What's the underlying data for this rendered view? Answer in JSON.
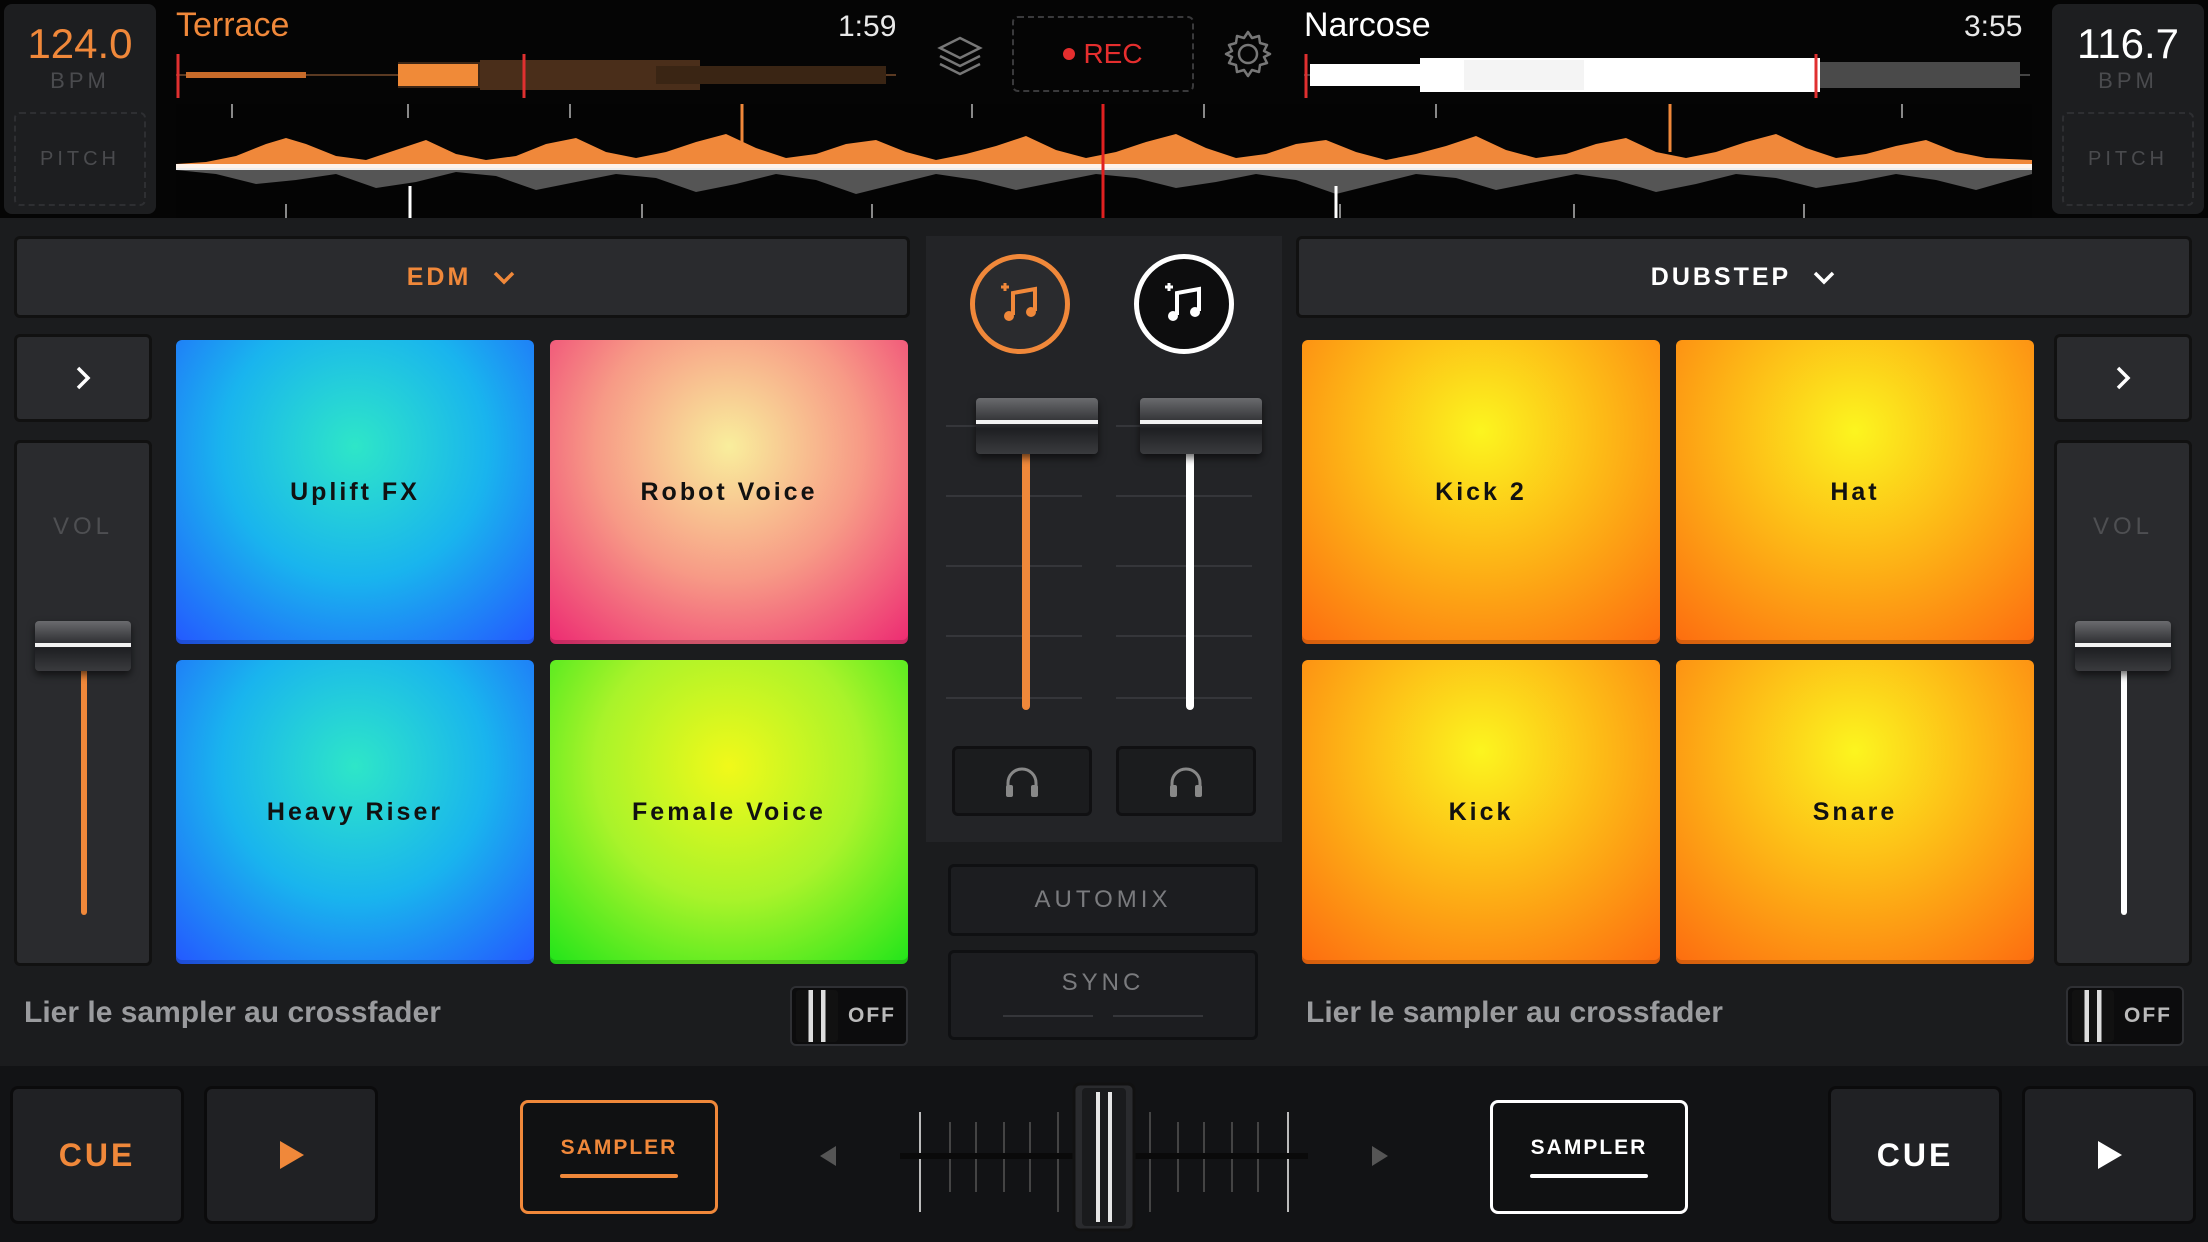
{
  "deck_a": {
    "bpm": "124.0",
    "bpm_unit": "BPM",
    "pitch_label": "PITCH",
    "track_title": "Terrace",
    "track_time": "1:59",
    "genre": "EDM",
    "vol_label": "VOL",
    "pads": [
      "Uplift FX",
      "Robot Voice",
      "Heavy Riser",
      "Female Voice"
    ],
    "crossfader_link_label": "Lier le sampler au crossfader",
    "toggle_label": "OFF",
    "cue_label": "CUE",
    "sampler_label": "SAMPLER",
    "accent_color": "#f0883a"
  },
  "deck_b": {
    "bpm": "116.7",
    "bpm_unit": "BPM",
    "pitch_label": "PITCH",
    "track_title": "Narcose",
    "track_time": "3:55",
    "genre": "DUBSTEP",
    "vol_label": "VOL",
    "pads": [
      "Kick 2",
      "Hat",
      "Kick",
      "Snare"
    ],
    "crossfader_link_label": "Lier le sampler au crossfader",
    "toggle_label": "OFF",
    "cue_label": "CUE",
    "sampler_label": "SAMPLER",
    "accent_color": "#ffffff"
  },
  "top": {
    "rec_label": "REC",
    "layers_icon": "layers-icon",
    "settings_icon": "gear-icon"
  },
  "mixer": {
    "automix_label": "AUTOMIX",
    "sync_label": "SYNC",
    "headphone_icon": "headphones-icon",
    "music_icon": "add-music-icon"
  },
  "colors": {
    "orange": "#f0883a",
    "rec_red": "#e52e2e",
    "background": "#1b1c1e"
  }
}
